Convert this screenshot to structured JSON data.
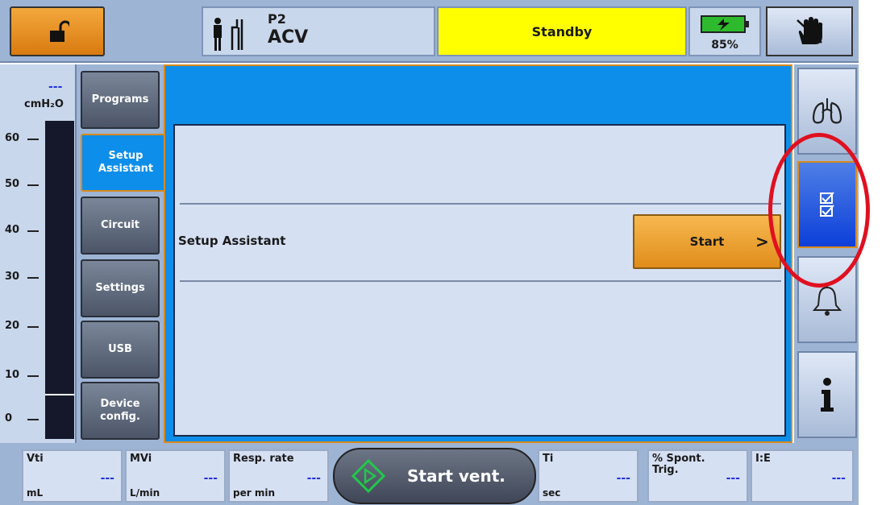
{
  "topbar": {
    "lock_icon": "unlock-icon",
    "patient_group": "P2",
    "mode": "ACV",
    "status": "Standby",
    "status_color": "#ffff00",
    "battery_percent": "85%",
    "battery_icon": "battery-charging-icon",
    "hand_icon": "hand-icon"
  },
  "gauge": {
    "value": "---",
    "unit": "cmH₂O",
    "ticks": [
      "60",
      "50",
      "40",
      "30",
      "20",
      "10",
      "0"
    ]
  },
  "tabs": [
    {
      "label": "Programs",
      "active": false
    },
    {
      "label": "Setup Assistant",
      "active": true
    },
    {
      "label": "Circuit",
      "active": false
    },
    {
      "label": "Settings",
      "active": false
    },
    {
      "label": "USB",
      "active": false
    },
    {
      "label": "Device config.",
      "active": false
    }
  ],
  "main": {
    "row_label": "Setup Assistant",
    "start_label": "Start",
    "start_chevron": ">"
  },
  "right_sidebar": [
    {
      "icon": "lungs-icon",
      "active": false
    },
    {
      "icon": "checklist-icon",
      "active": true
    },
    {
      "icon": "bell-icon",
      "active": false
    },
    {
      "icon": "info-icon",
      "active": false
    }
  ],
  "bottombar": {
    "params": [
      {
        "name": "Vti",
        "value": "---",
        "unit": "mL"
      },
      {
        "name": "MVi",
        "value": "---",
        "unit": "L/min"
      },
      {
        "name": "Resp. rate",
        "value": "---",
        "unit": "per min"
      },
      {
        "name": "Ti",
        "value": "---",
        "unit": "sec"
      },
      {
        "name": "% Spont. Trig.",
        "value": "---",
        "unit": ""
      },
      {
        "name": "I:E",
        "value": "---",
        "unit": ""
      }
    ],
    "start_vent_label": "Start vent."
  },
  "colors": {
    "accent_blue": "#0d8eea",
    "orange": "#e08d1a",
    "highlight_ring": "#e01020"
  }
}
